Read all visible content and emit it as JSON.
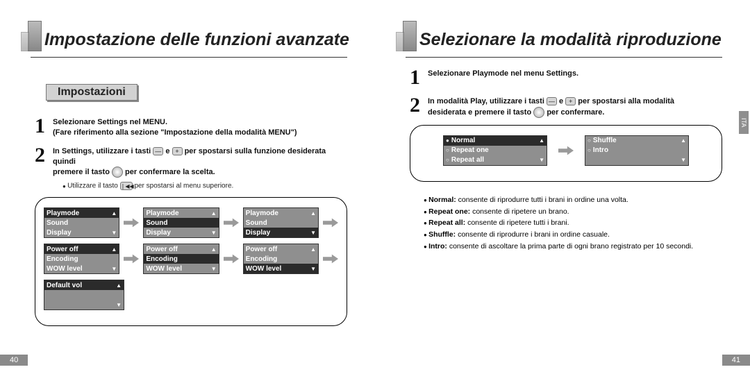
{
  "left": {
    "title": "Impostazione delle funzioni avanzate",
    "section": "Impostazioni",
    "step1_a": "Selezionare Settings nel MENU.",
    "step1_b": "(Fare riferimento alla sezione \"Impostazione della modalità MENU\")",
    "step2_a": "In Settings, utilizzare i tasti",
    "step2_b": "per spostarsi sulla funzione desiderata quindi",
    "step2_c": "premere il tasto",
    "step2_d": "per confermare la scelta.",
    "note_a": "Utilizzare il tasto",
    "note_b": "per spostarsi al menu superiore.",
    "menus": {
      "row1": {
        "labels": [
          "Playmode",
          "Sound",
          "Display"
        ],
        "sel": [
          0,
          1,
          2
        ]
      },
      "row2": {
        "labels": [
          "Power off",
          "Encoding",
          "WOW level"
        ],
        "sel": [
          0,
          1,
          2
        ]
      },
      "row3": {
        "labels": [
          "Default vol"
        ],
        "sel": [
          0
        ]
      }
    },
    "page_num": "40"
  },
  "right": {
    "title": "Selezionare la modalità riproduzione",
    "step1": "Selezionare Playmode nel menu Settings.",
    "step2_a": "In modalità Play, utilizzare i tasti",
    "step2_b": "per spostarsi alla modalità",
    "step2_c": "desiderata e premere il tasto",
    "step2_d": "per confermare.",
    "and": "e",
    "play_left": [
      "Normal",
      "Repeat one",
      "Repeat all"
    ],
    "play_right": [
      "Shuffle",
      "Intro"
    ],
    "descs": {
      "normal_t": "Normal:",
      "normal_d": "consente di riprodurre tutti i brani in ordine una volta.",
      "rone_t": "Repeat one:",
      "rone_d": "consente di ripetere un brano.",
      "rall_t": "Repeat all:",
      "rall_d": "consente di ripetere tutti i brani.",
      "shuf_t": "Shuffle:",
      "shuf_d": "consente di riprodurre i brani in ordine casuale.",
      "intro_t": "Intro:",
      "intro_d": "consente di ascoltare la prima parte di ogni brano registrato per 10 secondi."
    },
    "tab": "ITA",
    "page_num": "41"
  }
}
